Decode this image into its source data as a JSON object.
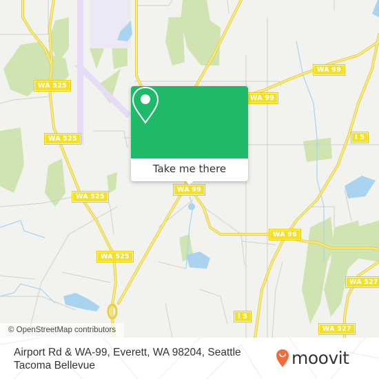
{
  "map": {
    "road_labels": [
      {
        "id": "wa525-1",
        "text": "WA 525"
      },
      {
        "id": "wa525-2",
        "text": "WA 525"
      },
      {
        "id": "wa525-3",
        "text": "WA 525"
      },
      {
        "id": "wa525-4",
        "text": "WA 525"
      },
      {
        "id": "wa99-1",
        "text": "WA 99"
      },
      {
        "id": "wa99-2",
        "text": "WA 99"
      },
      {
        "id": "wa99-3",
        "text": "WA 99"
      },
      {
        "id": "i5-1",
        "text": "I 5"
      },
      {
        "id": "i5-2",
        "text": "I 5"
      },
      {
        "id": "wa96",
        "text": "WA 96"
      },
      {
        "id": "wa527-1",
        "text": "WA 527"
      },
      {
        "id": "wa527-2",
        "text": "WA 527"
      }
    ],
    "colors": {
      "background": "#f2f2ee",
      "park": "#cfe4b0",
      "water": "#a9d3ee",
      "highway": "#f5e36a",
      "runway": "#e6dcf5",
      "street": "#cfcfcb"
    },
    "attribution": "© OpenStreetMap contributors"
  },
  "popup": {
    "icon": "location-pin-icon",
    "button_label": "Take me there",
    "accent_color": "#1fb96a"
  },
  "footer": {
    "address": "Airport Rd & WA-99, Everett, WA 98204, Seattle Tacoma Bellevue",
    "logo_text": "moovit",
    "logo_color": "#f26b3a"
  }
}
